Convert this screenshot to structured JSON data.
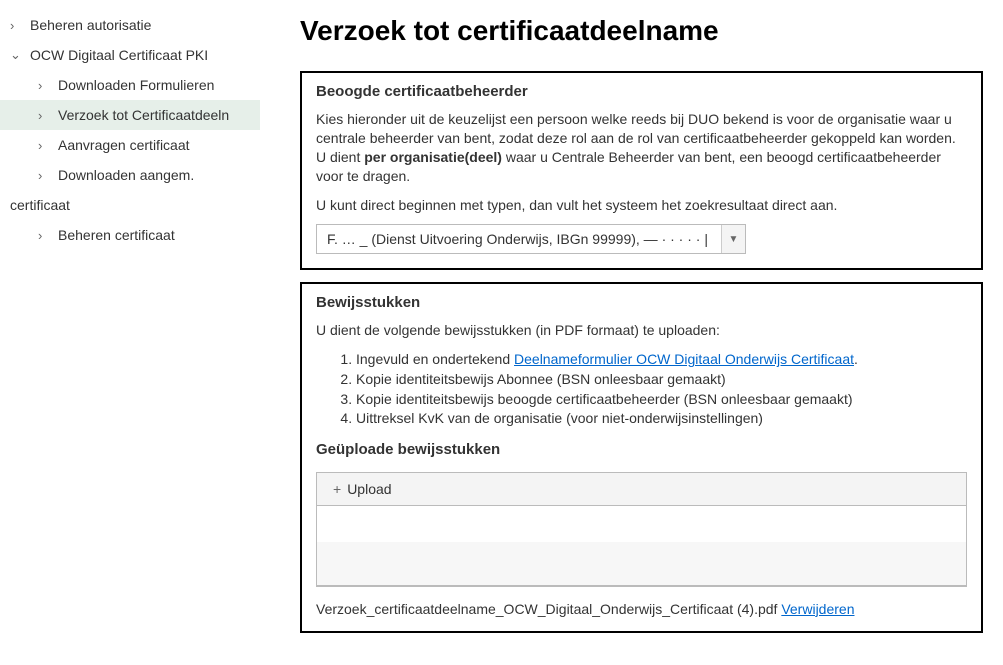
{
  "sidebar": {
    "top": "Beheren autorisatie",
    "group": "OCW Digitaal Certificaat PKI",
    "items": [
      "Downloaden Formulieren",
      "Verzoek tot Certificaatdeeln",
      "Aanvragen certificaat",
      "Downloaden aangem."
    ],
    "plain": "certificaat",
    "last": "Beheren certificaat"
  },
  "page": {
    "title": "Verzoek tot certificaatdeelname"
  },
  "panel1": {
    "title": "Beoogde certificaatbeheerder",
    "p1a": "Kies hieronder uit de keuzelijst een persoon welke reeds bij DUO bekend is voor de organisatie waar u centrale beheerder van bent, zodat deze rol aan de rol van certificaatbeheerder gekoppeld kan worden. U dient ",
    "p1b": "per organisatie(deel)",
    "p1c": " waar u Centrale Beheerder van bent, een beoogd certificaatbeheerder voor te dragen.",
    "p2": "U kunt direct beginnen met typen, dan vult het systeem het zoekresultaat direct aan.",
    "dropdown_value": "F. … _ (Dienst Uitvoering Onderwijs, IBGn 99999), — · · · · · |"
  },
  "panel2": {
    "title": "Bewijsstukken",
    "intro": "U dient de volgende bewijsstukken (in PDF formaat) te uploaden:",
    "li1a": "Ingevuld en ondertekend ",
    "li1link": "Deelnameformulier OCW Digitaal Onderwijs Certificaat",
    "li1b": ".",
    "li2": "Kopie identiteitsbewijs Abonnee (BSN onleesbaar gemaakt)",
    "li3": "Kopie identiteitsbewijs beoogde certificaatbeheerder (BSN onleesbaar gemaakt)",
    "li4": "Uittreksel KvK van de organisatie (voor niet-onderwijsinstellingen)",
    "uploaded_title": "Geüploade bewijsstukken",
    "upload_btn": "Upload",
    "file_name": "Verzoek_certificaatdeelname_OCW_Digitaal_Onderwijs_Certificaat (4).pdf ",
    "remove": "Verwijderen"
  }
}
